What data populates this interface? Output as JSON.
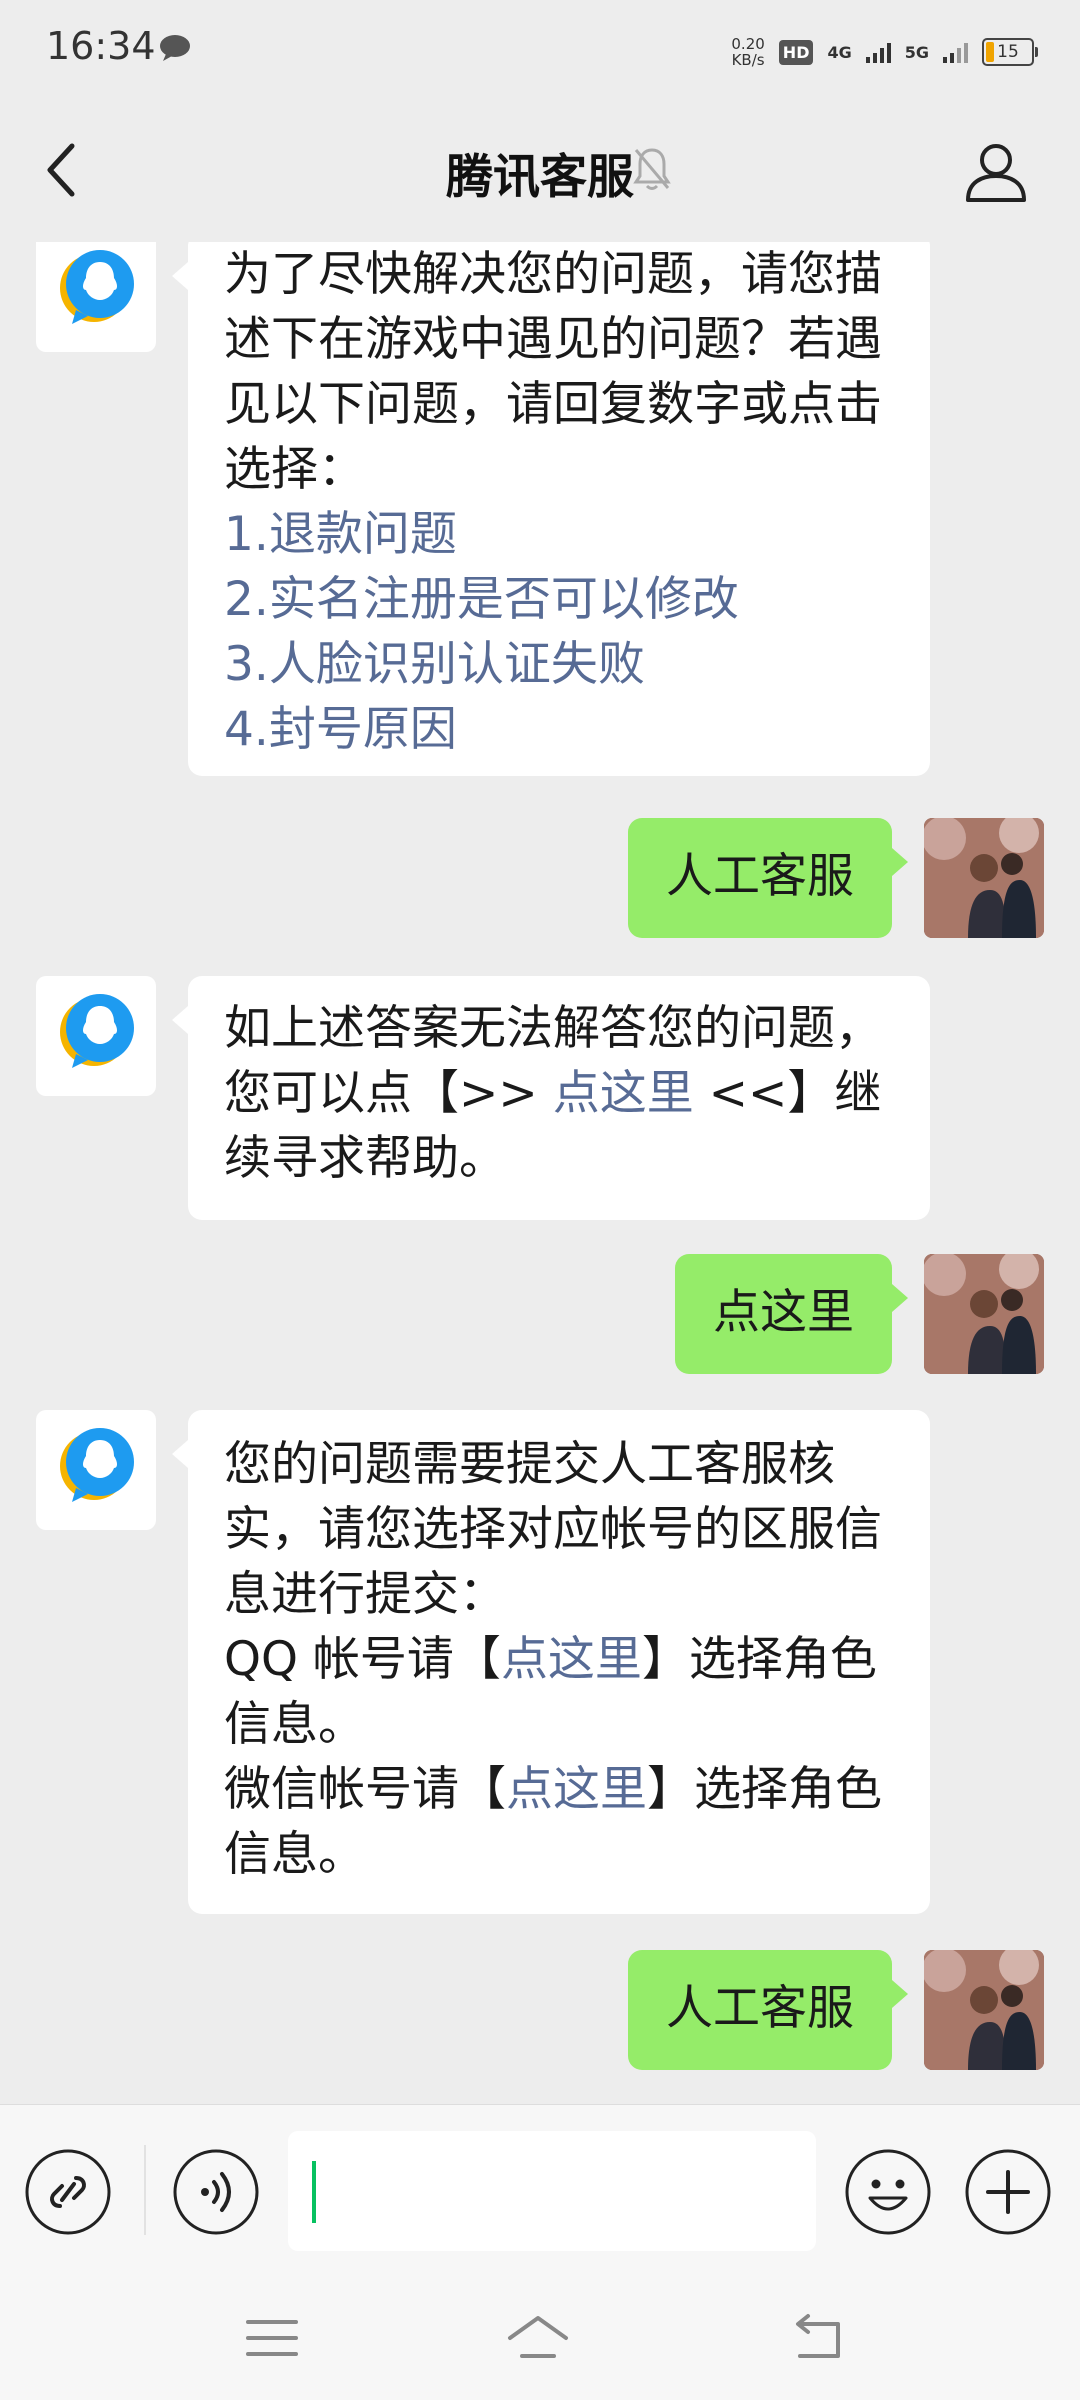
{
  "status_bar": {
    "time": "16:34",
    "net_speed_value": "0.20",
    "net_speed_unit": "KB/s",
    "hd_badge": "HD",
    "sim1_network": "4G",
    "sim2_network": "5G",
    "battery_level": "15"
  },
  "header": {
    "title": "腾讯客服"
  },
  "messages": [
    {
      "lines": [
        "为了尽快解决您的问题，请您描述下在游戏中遇见的问题？若遇见以下问题，请回复数字或点击选择："
      ],
      "options": [
        "1.退款问题",
        "2.实名注册是否可以修改",
        "3.人脸识别认证失败",
        "4.封号原因"
      ]
    },
    {
      "text": "人工客服"
    },
    {
      "pre": "如上述答案无法解答您的问题，您可以点【>> ",
      "link": "点这里",
      "post": " <<】继续寻求帮助。"
    },
    {
      "text": "点这里"
    },
    {
      "intro": "您的问题需要提交人工客服核实，请您选择对应帐号的区服信息进行提交：",
      "qq_pre": "QQ 帐号请【",
      "qq_link": "点这里",
      "qq_post": "】选择角色信息。",
      "wx_pre": "微信帐号请【",
      "wx_link": "点这里",
      "wx_post": "】选择角色信息。"
    },
    {
      "text": "人工客服"
    }
  ],
  "icons": {
    "back": "chevron-left-icon",
    "mute": "bell-off-icon",
    "profile": "person-icon",
    "mini_program": "link-icon",
    "voice": "voice-icon",
    "emoji": "smiley-icon",
    "more": "plus-icon",
    "nav_menu": "menu-icon",
    "nav_home": "home-icon",
    "nav_back": "return-icon"
  },
  "colors": {
    "outgoing_bubble": "#95ec69",
    "link": "#576b95",
    "cursor": "#07c160",
    "qq_blue": "#1e9bf0",
    "qq_yellow": "#f5b400"
  }
}
